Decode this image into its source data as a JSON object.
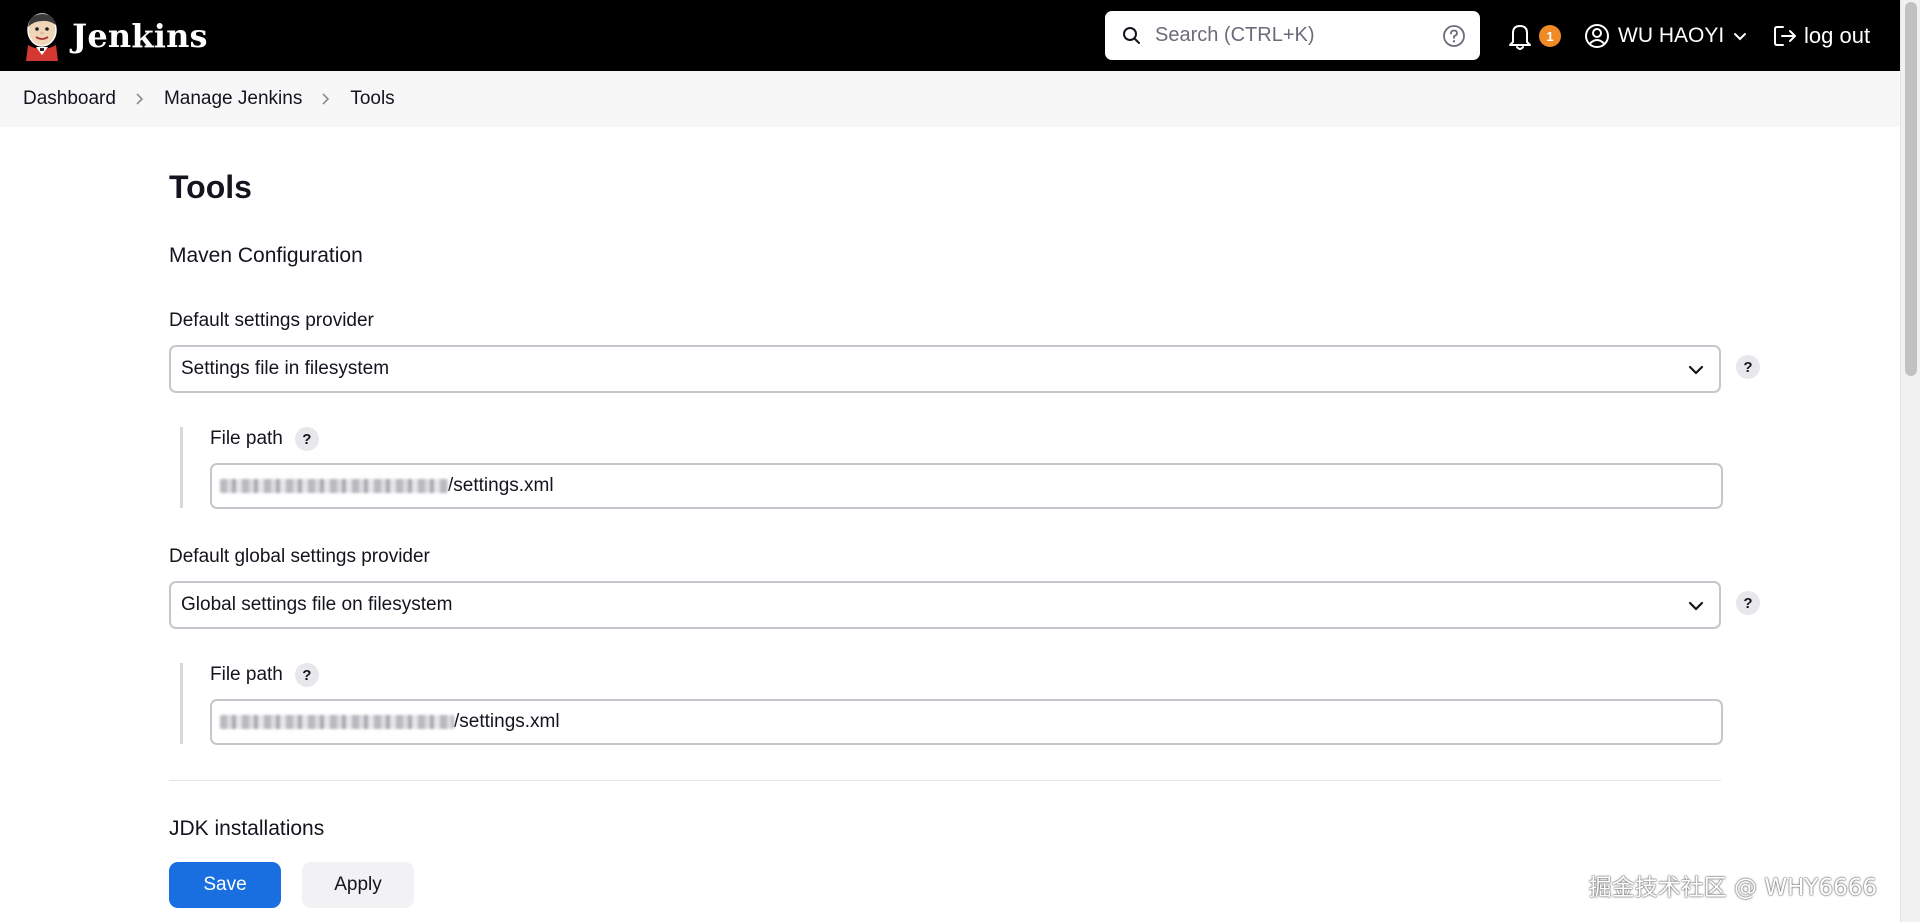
{
  "header": {
    "brand": "Jenkins",
    "search_placeholder": "Search (CTRL+K)",
    "notification_count": "1",
    "user_name": "WU HAOYI",
    "logout_label": "log out"
  },
  "breadcrumb": [
    "Dashboard",
    "Manage Jenkins",
    "Tools"
  ],
  "page": {
    "title": "Tools",
    "section_maven": "Maven Configuration",
    "default_settings_label": "Default settings provider",
    "default_settings_value": "Settings file in filesystem",
    "file_path_label_1": "File path",
    "file_path_value_1": "/settings.xml",
    "default_global_settings_label": "Default global settings provider",
    "default_global_settings_value": "Global settings file on filesystem",
    "file_path_label_2": "File path",
    "file_path_value_2": "/settings.xml",
    "section_jdk": "JDK installations"
  },
  "actions": {
    "save_label": "Save",
    "apply_label": "Apply"
  },
  "watermark": "掘金技术社区 @ WHY6666",
  "colors": {
    "header_bg": "#000000",
    "primary": "#1a6fe0",
    "badge": "#f08a24"
  }
}
